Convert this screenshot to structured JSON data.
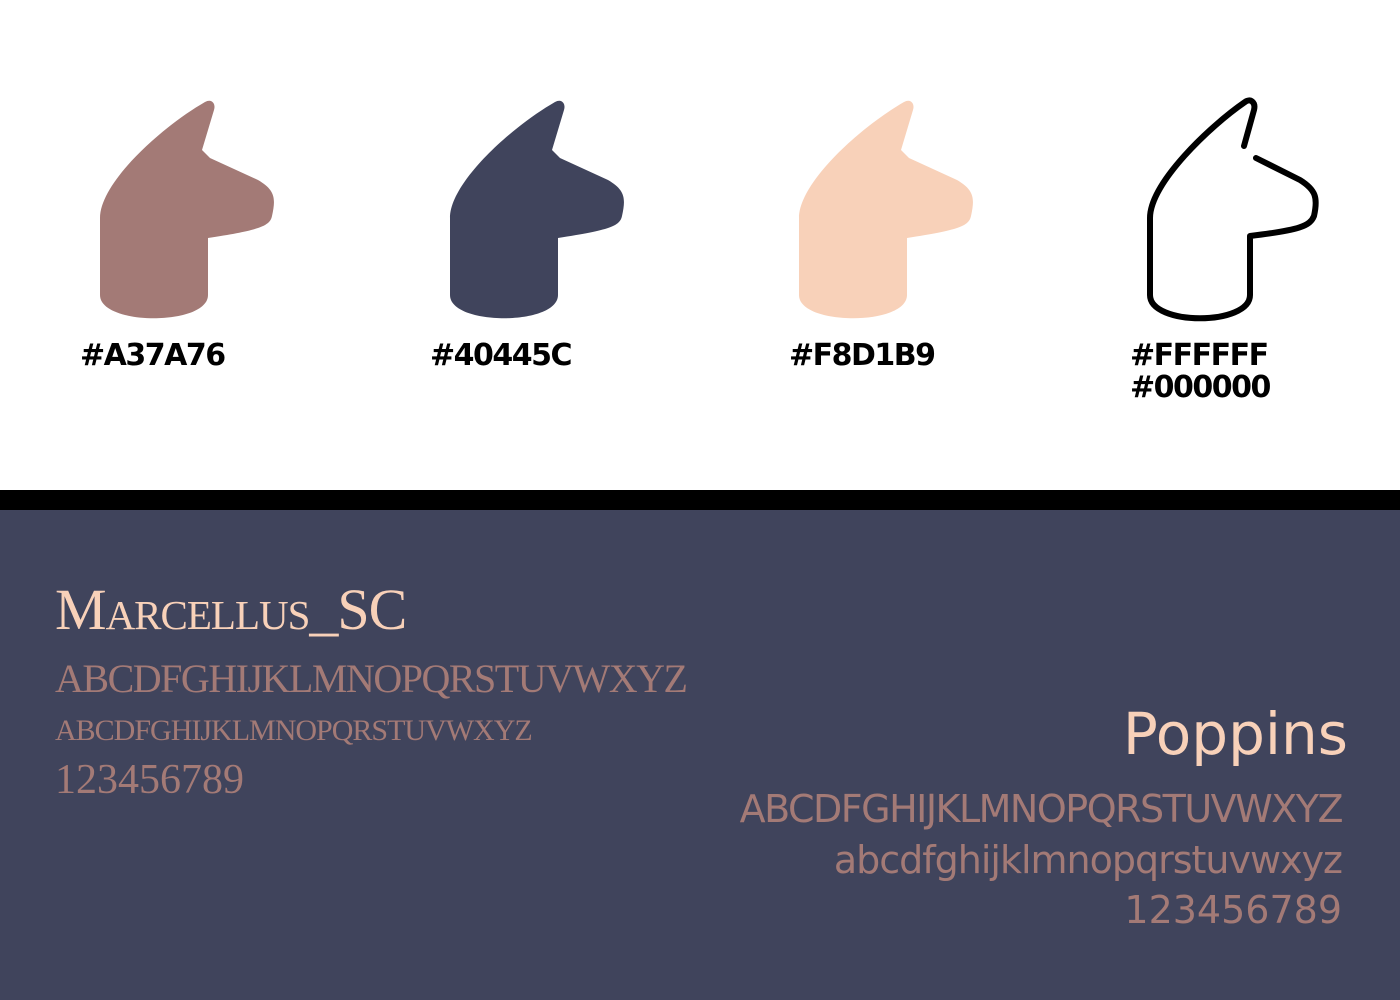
{
  "palette": [
    {
      "hex_label": "#A37A76",
      "color": "#A37A76"
    },
    {
      "hex_label": "#40445C",
      "color": "#40445C"
    },
    {
      "hex_label": "#F8D1B9",
      "color": "#F8D1B9"
    },
    {
      "hex_label": "#FFFFFF",
      "hex_label_2": "#000000",
      "color": "#FFFFFF",
      "stroke": "#000000"
    }
  ],
  "fonts": {
    "serif": {
      "name": "Marcellus_SC",
      "uppercase": "ABCDFGHIJKLMNOPQRSTUVWXYZ",
      "smallcaps": "ABCDFGHIJKLMNOPQRSTUVWXYZ",
      "digits": "123456789"
    },
    "sans": {
      "name": "Poppins",
      "uppercase": "ABCDFGHIJKLMNOPQRSTUVWXYZ",
      "lowercase": "abcdfghijklmnopqrstuvwxyz",
      "digits": "123456789"
    }
  }
}
